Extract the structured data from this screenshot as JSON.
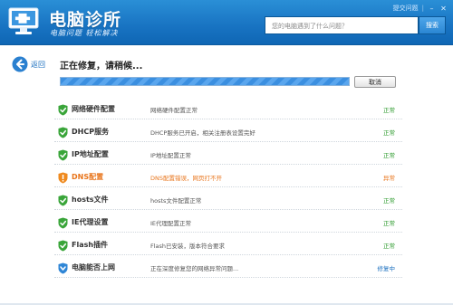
{
  "app": {
    "title": "电脑诊所",
    "subtitle": "电脑问题 轻松解决"
  },
  "topbar": {
    "feedback_label": "提交问题",
    "separator": "|"
  },
  "search": {
    "placeholder": "您的电脑遇到了什么问题？",
    "button_label": "搜索"
  },
  "nav": {
    "back_label": "返回"
  },
  "main": {
    "status_title": "正在修复，请稍候...",
    "progress_percent": 100,
    "cancel_label": "取消"
  },
  "colors": {
    "accent": "#1873c2",
    "ok": "#2e9b2e",
    "error": "#e8741a",
    "info": "#1a6fbf"
  },
  "items": [
    {
      "name": "网络硬件配置",
      "desc": "网络硬件配置正常",
      "state": "正常",
      "status": "ok",
      "icon": "shield-check-icon"
    },
    {
      "name": "DHCP服务",
      "desc": "DHCP服务已开启，相关注册表设置完好",
      "state": "正常",
      "status": "ok",
      "icon": "shield-check-icon"
    },
    {
      "name": "IP地址配置",
      "desc": "IP地址配置正常",
      "state": "正常",
      "status": "ok",
      "icon": "shield-check-icon"
    },
    {
      "name": "DNS配置",
      "desc": "DNS配置错误，网页打不开",
      "state": "异常",
      "status": "err",
      "icon": "shield-warning-icon"
    },
    {
      "name": "hosts文件",
      "desc": "hosts文件配置正常",
      "state": "正常",
      "status": "ok",
      "icon": "shield-check-icon"
    },
    {
      "name": "IE代理设置",
      "desc": "IE代理配置正常",
      "state": "正常",
      "status": "ok",
      "icon": "shield-check-icon"
    },
    {
      "name": "Flash插件",
      "desc": "Flash已安装，版本符合要求",
      "state": "正常",
      "status": "ok",
      "icon": "shield-check-icon"
    },
    {
      "name": "电脑能否上网",
      "desc": "正在深度修复您的网络异常问题...",
      "state": "修复中",
      "status": "fixing",
      "icon": "shield-fixing-icon"
    }
  ]
}
